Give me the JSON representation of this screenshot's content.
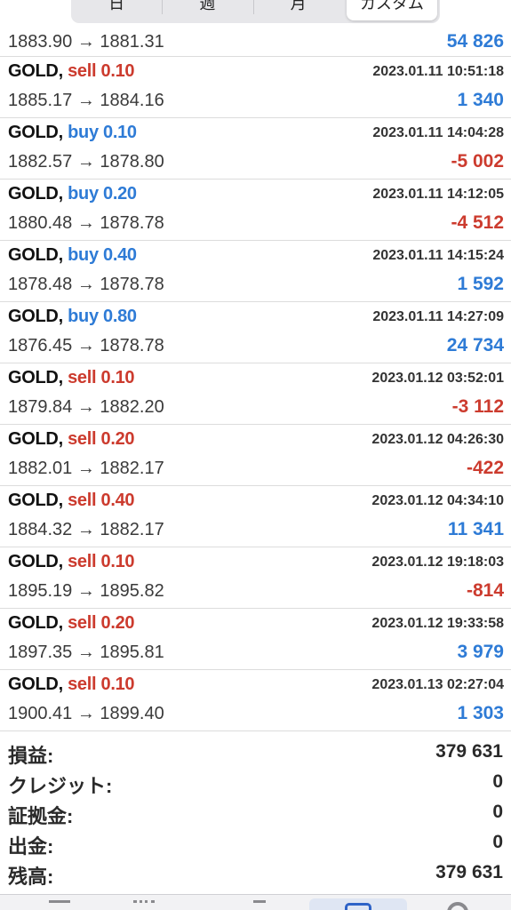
{
  "segments": [
    "日",
    "週",
    "月",
    "カスタム"
  ],
  "active_segment": "カスタム",
  "first_row": {
    "prices": "1883.90 → 1881.31",
    "profit": "54 826"
  },
  "trades": [
    {
      "symbol": "GOLD,",
      "side": "sell",
      "side_label": "sell 0.10",
      "time": "2023.01.11 10:51:18",
      "prices": "1885.17 → 1884.16",
      "profit": "1 340",
      "sign": "pos"
    },
    {
      "symbol": "GOLD,",
      "side": "buy",
      "side_label": "buy 0.10",
      "time": "2023.01.11 14:04:28",
      "prices": "1882.57 → 1878.80",
      "profit": "-5 002",
      "sign": "neg"
    },
    {
      "symbol": "GOLD,",
      "side": "buy",
      "side_label": "buy 0.20",
      "time": "2023.01.11 14:12:05",
      "prices": "1880.48 → 1878.78",
      "profit": "-4 512",
      "sign": "neg"
    },
    {
      "symbol": "GOLD,",
      "side": "buy",
      "side_label": "buy 0.40",
      "time": "2023.01.11 14:15:24",
      "prices": "1878.48 → 1878.78",
      "profit": "1 592",
      "sign": "pos"
    },
    {
      "symbol": "GOLD,",
      "side": "buy",
      "side_label": "buy 0.80",
      "time": "2023.01.11 14:27:09",
      "prices": "1876.45 → 1878.78",
      "profit": "24 734",
      "sign": "pos"
    },
    {
      "symbol": "GOLD,",
      "side": "sell",
      "side_label": "sell 0.10",
      "time": "2023.01.12 03:52:01",
      "prices": "1879.84 → 1882.20",
      "profit": "-3 112",
      "sign": "neg"
    },
    {
      "symbol": "GOLD,",
      "side": "sell",
      "side_label": "sell 0.20",
      "time": "2023.01.12 04:26:30",
      "prices": "1882.01 → 1882.17",
      "profit": "-422",
      "sign": "neg"
    },
    {
      "symbol": "GOLD,",
      "side": "sell",
      "side_label": "sell 0.40",
      "time": "2023.01.12 04:34:10",
      "prices": "1884.32 → 1882.17",
      "profit": "11 341",
      "sign": "pos"
    },
    {
      "symbol": "GOLD,",
      "side": "sell",
      "side_label": "sell 0.10",
      "time": "2023.01.12 19:18:03",
      "prices": "1895.19 → 1895.82",
      "profit": "-814",
      "sign": "neg"
    },
    {
      "symbol": "GOLD,",
      "side": "sell",
      "side_label": "sell 0.20",
      "time": "2023.01.12 19:33:58",
      "prices": "1897.35 → 1895.81",
      "profit": "3 979",
      "sign": "pos"
    },
    {
      "symbol": "GOLD,",
      "side": "sell",
      "side_label": "sell 0.10",
      "time": "2023.01.13 02:27:04",
      "prices": "1900.41 → 1899.40",
      "profit": "1 303",
      "sign": "pos"
    }
  ],
  "summary": [
    {
      "label": "損益:",
      "value": "379 631"
    },
    {
      "label": "クレジット:",
      "value": "0"
    },
    {
      "label": "証拠金:",
      "value": "0"
    },
    {
      "label": "出金:",
      "value": "0"
    },
    {
      "label": "残高:",
      "value": "379 631"
    }
  ],
  "colors": {
    "buy": "#2e7bd6",
    "sell": "#cc3b2e",
    "active_tab": "#2e63c7"
  },
  "tabbar_icons": [
    "quotes-icon",
    "chart-icon",
    "trade-icon",
    "history-icon",
    "settings-icon"
  ],
  "active_tab_icon": "history-icon"
}
